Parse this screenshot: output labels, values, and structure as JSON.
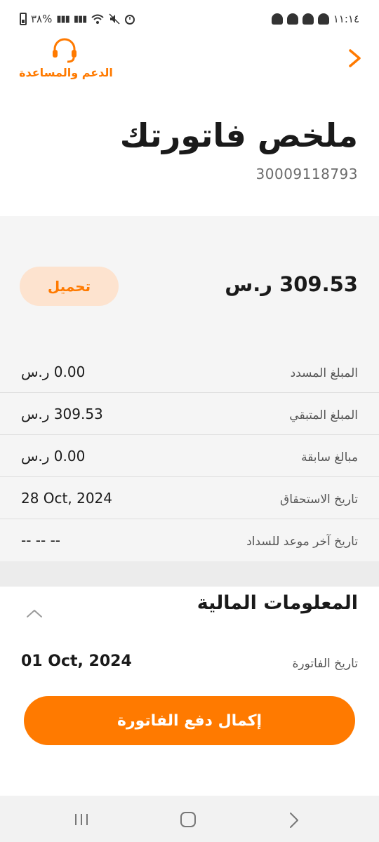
{
  "status_bar": {
    "left_text": "٣٨%",
    "time": "١١:١٤"
  },
  "header": {
    "support_label": "الدعم والمساعدة",
    "title": "ملخص فاتورتك",
    "account_number": "30009118793"
  },
  "summary": {
    "total": "309.53 ر.س",
    "download_label": "تحميل",
    "rows": [
      {
        "label": "المبلغ المسدد",
        "value": "0.00 ر.س"
      },
      {
        "label": "المبلغ المتبقي",
        "value": "309.53 ر.س"
      },
      {
        "label": "مبالغ سابقة",
        "value": "0.00 ر.س"
      },
      {
        "label": "تاريخ الاستحقاق",
        "value": "28 Oct, 2024"
      },
      {
        "label": "تاريخ آخر موعد للسداد",
        "value": "-- -- --"
      }
    ]
  },
  "financial": {
    "title": "المعلومات المالية",
    "invoice_date_label": "تاريخ الفاتورة",
    "invoice_date_value": "01 Oct, 2024",
    "pay_button_label": "إكمال دفع الفاتورة"
  },
  "colors": {
    "accent": "#ff7a00",
    "accent_light": "#fde3cf",
    "card_bg": "#f5f5f5"
  },
  "icons": {
    "support": "headset-icon",
    "back": "chevron-right-icon",
    "collapse": "chevron-up-icon"
  }
}
